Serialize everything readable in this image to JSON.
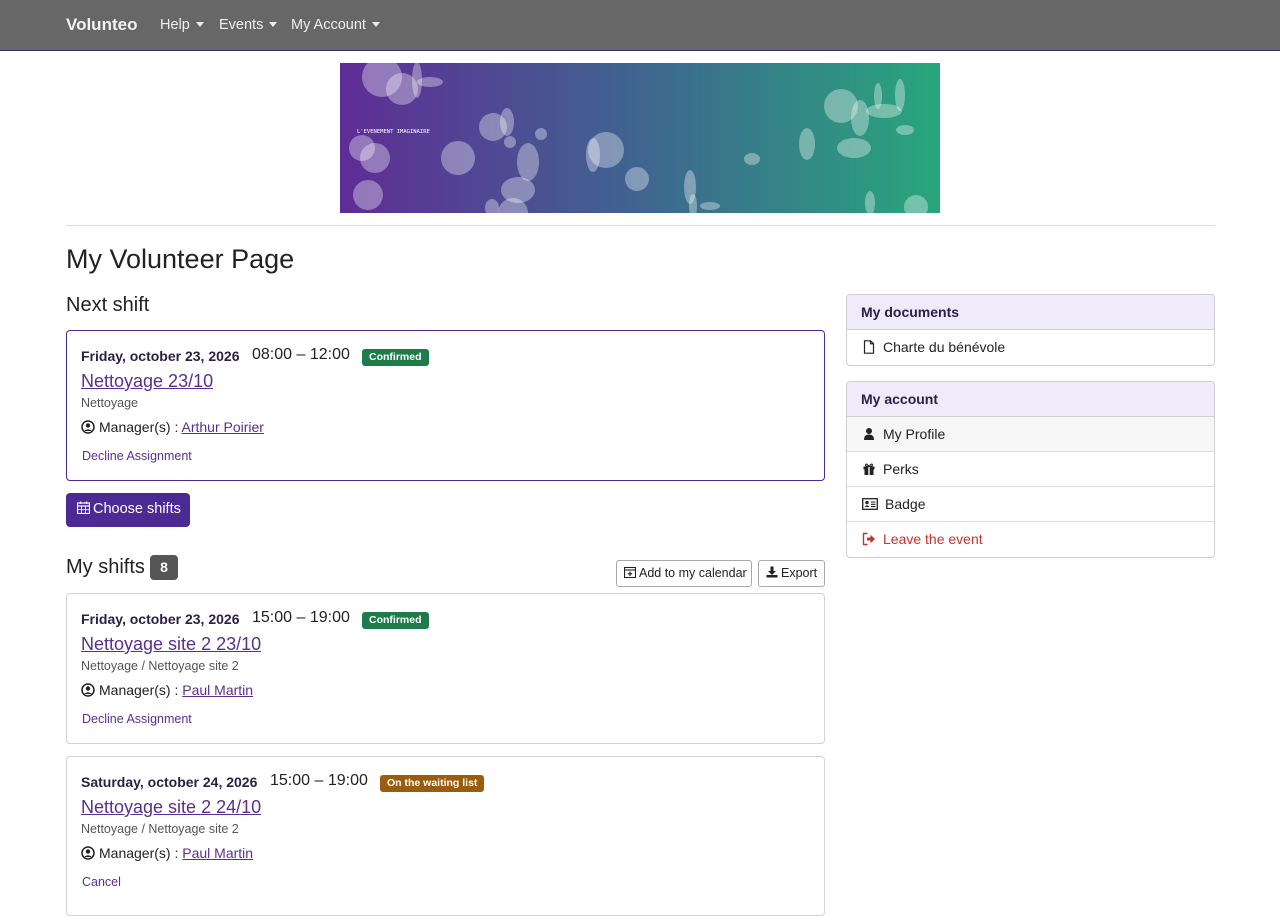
{
  "navbar": {
    "brand": "Volunteo",
    "items": [
      {
        "label": "Help"
      },
      {
        "label": "Events"
      },
      {
        "label": "My Account"
      }
    ]
  },
  "banner": {
    "text": "L'EVENEMENT IMAGINAIRE"
  },
  "page": {
    "title": "My Volunteer Page",
    "next_shift_heading": "Next shift",
    "choose_shifts_label": "Choose shifts",
    "my_shifts_heading": "My shifts",
    "my_shifts_count": "8",
    "add_calendar_label": "Add to my calendar",
    "export_label": "Export"
  },
  "next_shift": {
    "date": "Friday, october 23, 2026",
    "time": "08:00 – 12:00",
    "status": "Confirmed",
    "title": "Nettoyage 23/10",
    "subtitle": "Nettoyage",
    "manager_label": "Manager(s) :",
    "manager": "Arthur Poirier",
    "action": "Decline Assignment"
  },
  "shifts": [
    {
      "date": "Friday, october 23, 2026",
      "time": "15:00 – 19:00",
      "status": "Confirmed",
      "title": "Nettoyage site 2 23/10",
      "subtitle": "Nettoyage / Nettoyage site 2",
      "manager_label": "Manager(s) :",
      "manager": "Paul Martin",
      "action": "Decline Assignment"
    },
    {
      "date": "Saturday, october 24, 2026",
      "time": "15:00 – 19:00",
      "status": "On the waiting list",
      "title": "Nettoyage site 2 24/10",
      "subtitle": "Nettoyage / Nettoyage site 2",
      "manager_label": "Manager(s) :",
      "manager": "Paul Martin",
      "action": "Cancel"
    }
  ],
  "sidebar": {
    "documents": {
      "heading": "My documents",
      "items": [
        {
          "label": "Charte du bénévole",
          "icon": "file-icon"
        }
      ]
    },
    "account": {
      "heading": "My account",
      "items": [
        {
          "label": "My Profile",
          "icon": "user-icon"
        },
        {
          "label": "Perks",
          "icon": "gift-icon"
        },
        {
          "label": "Badge",
          "icon": "id-card-icon"
        },
        {
          "label": "Leave the event",
          "icon": "sign-out-icon"
        }
      ]
    }
  },
  "colors": {
    "primary": "#4b2a93",
    "navbar": "#676767",
    "confirmed": "#1e7c4a",
    "waiting": "#9a5c0d",
    "danger": "#c9302c"
  }
}
